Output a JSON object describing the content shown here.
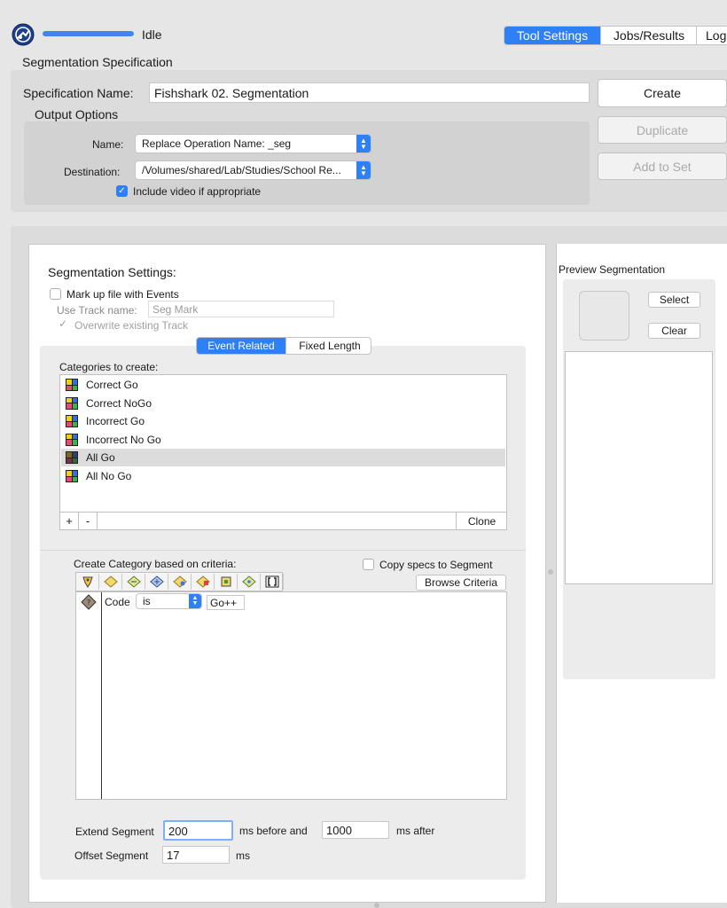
{
  "topbar": {
    "status": "Idle",
    "progress": 1.0,
    "tabs": [
      "Tool Settings",
      "Jobs/Results",
      "Log"
    ],
    "active_tab": 0
  },
  "spec": {
    "section_title": "Segmentation Specification",
    "name_label": "Specification Name:",
    "name_value": "Fishshark 02. Segmentation",
    "output_title": "Output Options",
    "out_name_label": "Name:",
    "out_name_value": "Replace Operation Name: _seg",
    "destination_label": "Destination:",
    "destination_value": "/Volumes/shared/Lab/Studies/School Re...",
    "include_video_label": "Include video if appropriate",
    "include_video_checked": true,
    "create_label": "Create",
    "duplicate_label": "Duplicate",
    "add_to_set_label": "Add to Set"
  },
  "settings": {
    "title": "Segmentation Settings:",
    "markup_label": "Mark up file with Events",
    "track_name_label": "Use Track name:",
    "track_name_value": "Seg Mark",
    "overwrite_label": "Overwrite existing Track",
    "tabs": [
      "Event Related",
      "Fixed Length"
    ],
    "categories_label": "Categories to create:",
    "categories": [
      {
        "name": "Correct Go",
        "colors": [
          "#f2d300",
          "#2f6fe0",
          "#e8487a",
          "#37b54a"
        ]
      },
      {
        "name": "Correct NoGo",
        "colors": [
          "#f2d300",
          "#2f6fe0",
          "#e8487a",
          "#37b54a"
        ]
      },
      {
        "name": "Incorrect Go",
        "colors": [
          "#f2d300",
          "#2f6fe0",
          "#e8487a",
          "#37b54a"
        ]
      },
      {
        "name": "Incorrect No Go",
        "colors": [
          "#f2d300",
          "#2f6fe0",
          "#e8487a",
          "#37b54a"
        ]
      },
      {
        "name": "All Go",
        "colors": [
          "#7a6a20",
          "#2a3f70",
          "#7a3045",
          "#2f6a38"
        ]
      },
      {
        "name": "All No Go",
        "colors": [
          "#f2d300",
          "#2f6fe0",
          "#e8487a",
          "#37b54a"
        ]
      }
    ],
    "selected_category": 4,
    "add_label": "+",
    "remove_label": "-",
    "clone_label": "Clone",
    "criteria_label": "Create Category based on criteria:",
    "copy_specs_label": "Copy specs to Segment",
    "browse_label": "Browse Criteria",
    "criteria_icons": [
      "event-icon",
      "diamond-event-icon",
      "diamond-range-icon",
      "diamond-cross-icon",
      "diamond-select-icon",
      "diamond-flag-icon",
      "square-target-icon",
      "diamond-dot-icon",
      "brackets-icon"
    ],
    "criterion": {
      "field": "Code",
      "op": "is",
      "value": "Go++"
    },
    "extend_label": "Extend Segment",
    "extend_before": "200",
    "before_label": "ms before and",
    "extend_after": "1000",
    "after_label": "ms after",
    "offset_label": "Offset Segment",
    "offset_value": "17",
    "ms_label": "ms"
  },
  "preview": {
    "title": "Preview Segmentation",
    "select_label": "Select",
    "clear_label": "Clear"
  },
  "colors": {
    "accent": "#2f7ff5"
  }
}
